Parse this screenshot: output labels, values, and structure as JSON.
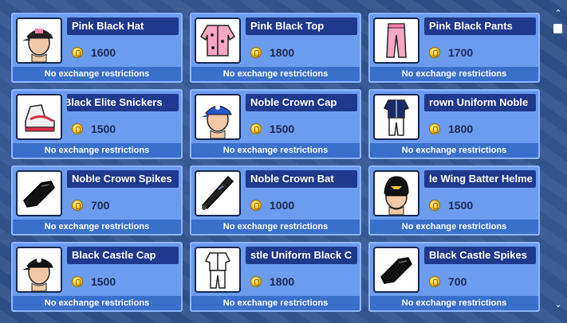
{
  "restriction_text": "No exchange restrictions",
  "colors": {
    "card_bg": "#6c9cf0",
    "name_bg": "#1e3a8e",
    "restriction_bg": "#3b6fcc",
    "coin": "#f4c21c"
  },
  "items": [
    {
      "name": "Pink Black Hat",
      "price": "1600",
      "icon": "cap-on-head-icon",
      "s_badge": false,
      "fx_badge": true
    },
    {
      "name": "Pink Black Top",
      "price": "1800",
      "icon": "jacket-icon",
      "s_badge": true,
      "fx_badge": true
    },
    {
      "name": "Pink Black Pants",
      "price": "1700",
      "icon": "pants-icon",
      "s_badge": true,
      "fx_badge": true
    },
    {
      "name": "Black Elite Snickers",
      "price": "1500",
      "icon": "sneaker-icon",
      "s_badge": true,
      "fx_badge": true
    },
    {
      "name": "Noble Crown Cap",
      "price": "1500",
      "icon": "cap-on-head-icon",
      "s_badge": false,
      "fx_badge": false
    },
    {
      "name": "Noble Crown Uniform",
      "price": "1800",
      "icon": "uniform-icon",
      "s_badge": true,
      "fx_badge": false
    },
    {
      "name": "Noble Crown Spikes",
      "price": "700",
      "icon": "cleats-icon",
      "s_badge": true,
      "fx_badge": false
    },
    {
      "name": "Noble Crown Bat",
      "price": "1000",
      "icon": "bat-icon",
      "s_badge": false,
      "fx_badge": false
    },
    {
      "name": "Noble Wing Batter Helmet",
      "price": "1500",
      "icon": "helmet-icon",
      "s_badge": false,
      "fx_badge": false
    },
    {
      "name": "Black Castle Cap",
      "price": "1500",
      "icon": "cap-on-head-icon",
      "s_badge": false,
      "fx_badge": false
    },
    {
      "name": "Black Castle Uniform",
      "price": "1800",
      "icon": "uniform-icon",
      "s_badge": true,
      "fx_badge": false
    },
    {
      "name": "Black Castle Spikes",
      "price": "700",
      "icon": "cleats-icon",
      "s_badge": true,
      "fx_badge": false
    }
  ],
  "visible_names": [
    "Pink Black Hat",
    "Pink Black Top",
    "Pink Black Pants",
    "Black Elite Snickers",
    "Noble Crown Cap",
    "rown Uniform      Noble",
    "Noble Crown Spikes",
    "Noble Crown Bat",
    "le Wing Batter Helme",
    "Black Castle Cap",
    "stle Uniform      Black C",
    "Black Castle Spikes"
  ],
  "scrollbar": {
    "up": "^",
    "down": "v"
  }
}
